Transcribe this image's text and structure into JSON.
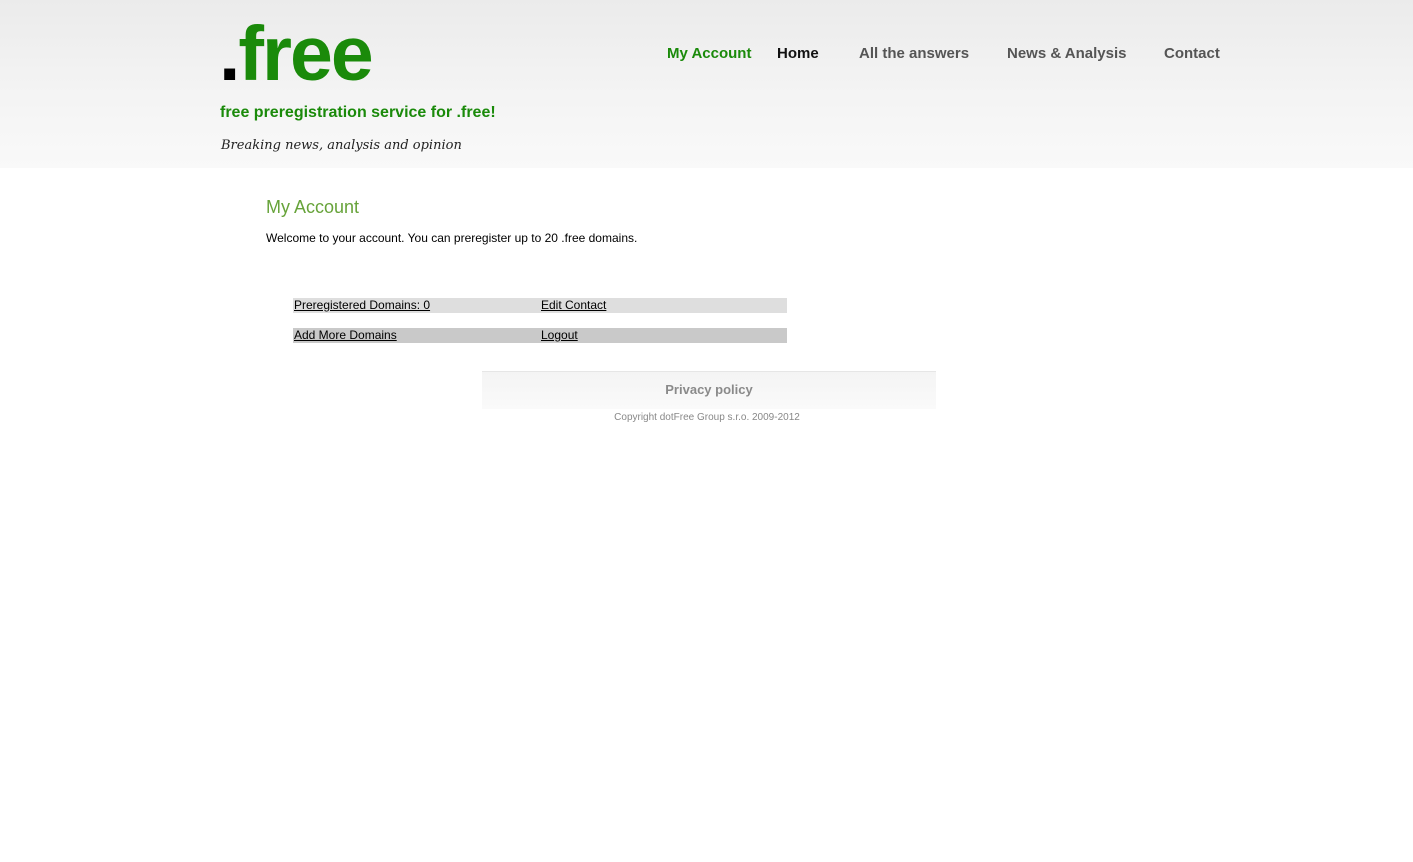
{
  "header": {
    "logo_dot": ".",
    "logo_text": "free",
    "tagline": "free preregistration service for .free!",
    "subtagline": "Breaking news, analysis and opinion"
  },
  "nav": {
    "items": [
      {
        "label": "My Account",
        "state": "active"
      },
      {
        "label": "Home"
      },
      {
        "label": "All the answers"
      },
      {
        "label": "News & Analysis"
      },
      {
        "label": "Contact"
      }
    ]
  },
  "main": {
    "title": "My Account",
    "welcome": "Welcome to your account. You can preregister up to 20 .free domains.",
    "rows": [
      {
        "left": "Preregistered Domains: 0",
        "right": "Edit Contact"
      },
      {
        "left": "Add More Domains",
        "right": "Logout"
      }
    ]
  },
  "footer": {
    "privacy": "Privacy policy",
    "copyright": "Copyright dotFree Group s.r.o. 2009-2012"
  },
  "colors": {
    "brand_green": "#1a8a0a",
    "title_green": "#67a33a"
  }
}
